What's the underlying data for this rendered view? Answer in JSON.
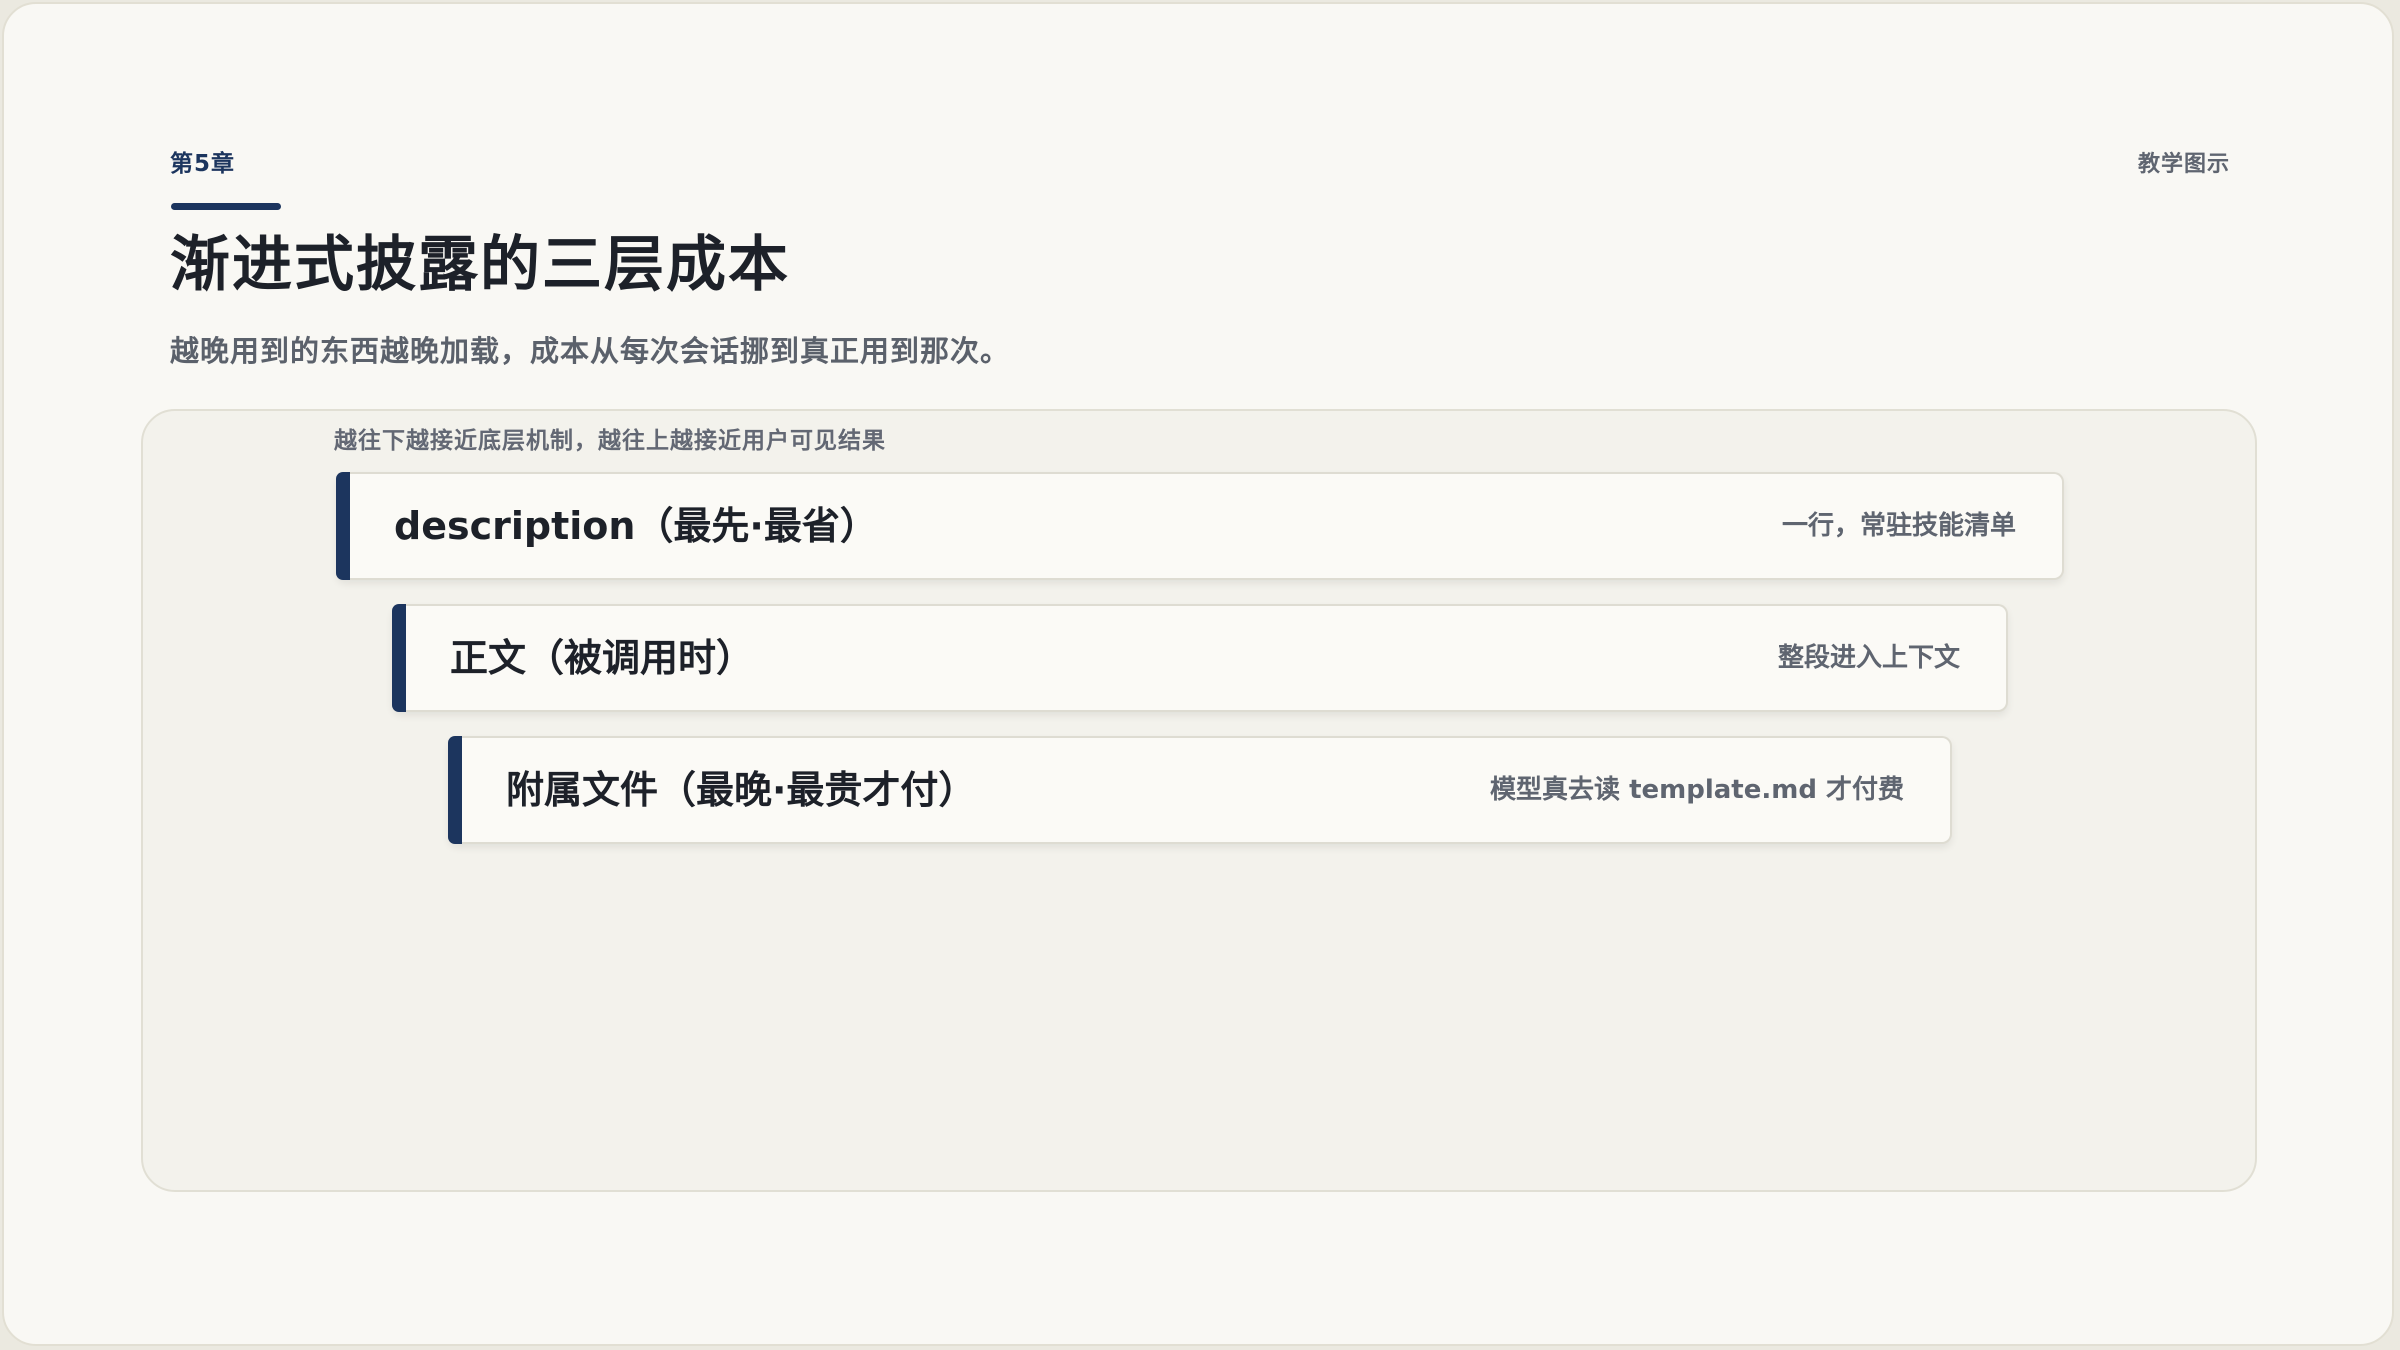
{
  "header": {
    "chapter": "第5章",
    "tag": "教学图示",
    "title": "渐进式披露的三层成本",
    "subtitle": "越晚用到的东西越晚加载，成本从每次会话挪到真正用到那次。"
  },
  "diagram": {
    "axis_note": "越往下越接近底层机制，越往上越接近用户可见结果",
    "accent_color": "#1c355e",
    "layers": [
      {
        "label": "description（最先·最省）",
        "note": "一行，常驻技能清单"
      },
      {
        "label": "正文（被调用时）",
        "note": "整段进入上下文"
      },
      {
        "label": "附属文件（最晚·最贵才付）",
        "note": "模型真去读 template.md 才付费"
      }
    ]
  }
}
